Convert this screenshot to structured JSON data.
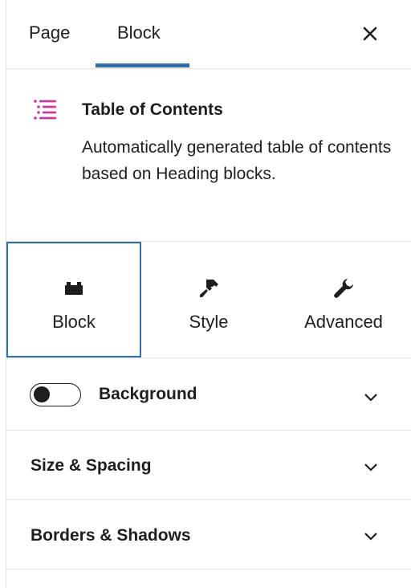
{
  "header": {
    "tabs": [
      {
        "label": "Page",
        "active": false
      },
      {
        "label": "Block",
        "active": true
      }
    ],
    "close_icon": "close-icon",
    "accent": "#2f6ea8"
  },
  "block": {
    "icon": "table-of-contents-icon",
    "title": "Table of Contents",
    "description": "Automatically generated table of contents based on Heading blocks."
  },
  "settings_tabs": [
    {
      "label": "Block",
      "icon": "block-icon",
      "active": true
    },
    {
      "label": "Style",
      "icon": "brush-icon",
      "active": false
    },
    {
      "label": "Advanced",
      "icon": "wrench-icon",
      "active": false
    }
  ],
  "panels": {
    "background": {
      "title": "Background",
      "toggle_on": false
    },
    "size_spacing": {
      "title": "Size & Spacing"
    },
    "borders_shadows": {
      "title": "Borders & Shadows"
    }
  }
}
